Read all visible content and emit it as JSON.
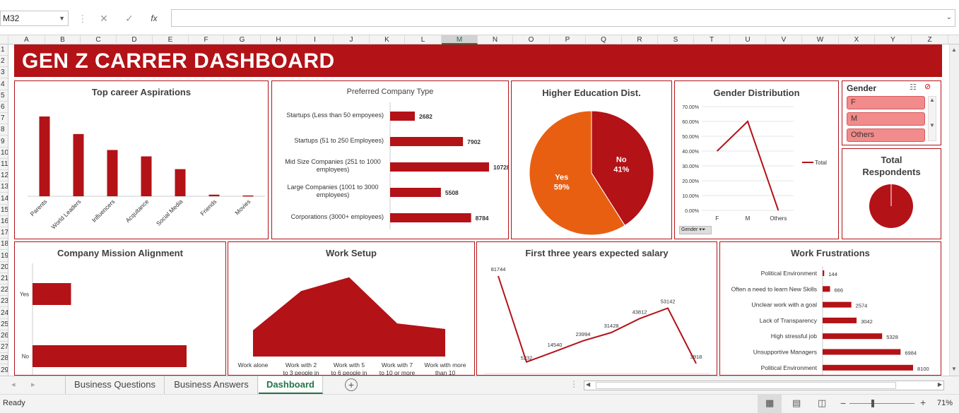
{
  "formula_bar": {
    "name_box": "M32",
    "cancel_icon": "✕",
    "enter_icon": "✓",
    "fx_label": "fx",
    "formula": ""
  },
  "columns": [
    "A",
    "B",
    "C",
    "D",
    "E",
    "F",
    "G",
    "H",
    "I",
    "J",
    "K",
    "L",
    "M",
    "N",
    "O",
    "P",
    "Q",
    "R",
    "S",
    "T",
    "U",
    "V",
    "W",
    "X",
    "Y",
    "Z"
  ],
  "selected_column": "M",
  "rows": [
    "1",
    "2",
    "3",
    "4",
    "5",
    "6",
    "7",
    "8",
    "9",
    "10",
    "11",
    "12",
    "13",
    "14",
    "15",
    "16",
    "17",
    "18",
    "19",
    "20",
    "21",
    "22",
    "23",
    "24",
    "25",
    "26",
    "27",
    "28",
    "29"
  ],
  "dashboard": {
    "title": "GEN Z CARRER DASHBOARD",
    "brand_color": "#b31217"
  },
  "panels": {
    "career": {
      "title": "Top career Aspirations"
    },
    "company_type": {
      "title": "Preferred Company Type"
    },
    "higher_ed": {
      "title": "Higher Education Dist."
    },
    "gender": {
      "title": "Gender Distribution",
      "filter_label": "Gender"
    },
    "slicer": {
      "title": "Gender",
      "items": [
        "F",
        "M",
        "Others"
      ]
    },
    "total": {
      "title": "Total Respondents"
    },
    "mission": {
      "title": "Company Mission Alignment"
    },
    "work_setup": {
      "title": "Work Setup"
    },
    "salary": {
      "title": "First three years expected salary"
    },
    "frustrations": {
      "title": "Work Frustrations"
    }
  },
  "chart_data": [
    {
      "id": "career",
      "type": "bar",
      "categories": [
        "Parents",
        "World Leaders",
        "Influencers",
        "Acquitance",
        "Social Media",
        "Friends",
        "Movies"
      ],
      "values": [
        100,
        78,
        58,
        50,
        34,
        2,
        1
      ]
    },
    {
      "id": "company_type",
      "type": "bar",
      "orientation": "horizontal",
      "categories": [
        "Startups (Less than 50 empoyees)",
        "Startups (51 to 250 Employees)",
        "Mid Size Companies (251 to 1000 employees)",
        "Large Companies (1001 to 3000 employees)",
        "Corporations (3000+ employees)"
      ],
      "values": [
        2682,
        7902,
        10728,
        5508,
        8784
      ]
    },
    {
      "id": "higher_ed",
      "type": "pie",
      "labels": [
        "No",
        "Yes"
      ],
      "values": [
        41,
        59
      ],
      "value_labels": [
        "41%",
        "59%"
      ],
      "colors": [
        "#b31217",
        "#e85f12"
      ]
    },
    {
      "id": "gender",
      "type": "line",
      "categories": [
        "F",
        "M",
        "Others"
      ],
      "values": [
        0.4,
        0.6,
        0.0
      ],
      "ylim": [
        0,
        0.7
      ],
      "yticks": [
        "0.00%",
        "10.00%",
        "20.00%",
        "30.00%",
        "40.00%",
        "50.00%",
        "60.00%",
        "70.00%"
      ],
      "series": [
        {
          "name": "Total"
        }
      ]
    },
    {
      "id": "total",
      "type": "pie",
      "values": [
        100
      ]
    },
    {
      "id": "mission",
      "type": "bar",
      "orientation": "horizontal",
      "categories": [
        "Yes",
        "No"
      ],
      "values": [
        25,
        100
      ]
    },
    {
      "id": "work_setup",
      "type": "area",
      "categories": [
        "Work alone",
        "Work with 2 to 3 people in",
        "Work with 5 to 6 people in",
        "Work with 7 to 10 or more",
        "Work with more than 10"
      ],
      "values": [
        38,
        95,
        115,
        48,
        40
      ]
    },
    {
      "id": "salary",
      "type": "line",
      "values": [
        81744,
        5232,
        14540,
        23994,
        31428,
        43812,
        53142,
        3918
      ],
      "value_labels": [
        "81744",
        "5232",
        "14540",
        "23994",
        "31428",
        "43812",
        "53142",
        "3918"
      ]
    },
    {
      "id": "frustrations",
      "type": "bar",
      "orientation": "horizontal",
      "categories": [
        "Political Environment",
        "Often a need to learn New Skills",
        "Unclear work with a goal",
        "Lack of Transparency",
        "High stressful job",
        "Unsupportive Managers",
        "Political Environment"
      ],
      "values": [
        144,
        666,
        2574,
        3042,
        5328,
        6984,
        8100
      ]
    }
  ],
  "sheet_tabs": [
    "Business Questions",
    "Business Answers",
    "Dashboard"
  ],
  "active_tab": "Dashboard",
  "status": {
    "ready": "Ready",
    "zoom": "71%"
  }
}
